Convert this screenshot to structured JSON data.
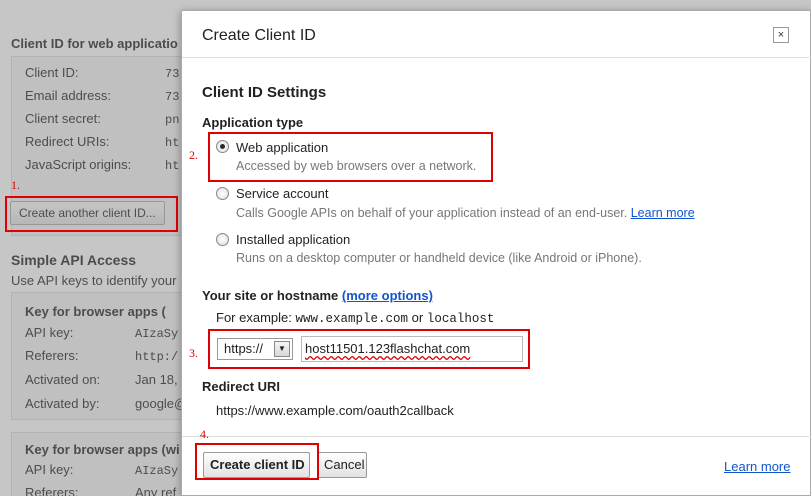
{
  "background": {
    "web_app_heading": "Client ID for web applicatio",
    "web_app_rows": [
      {
        "label": "Client ID:",
        "value": "73"
      },
      {
        "label": "Email address:",
        "value": "73"
      },
      {
        "label": "Client secret:",
        "value": "pn"
      },
      {
        "label": "Redirect URIs:",
        "value": "ht"
      },
      {
        "label": "JavaScript origins:",
        "value": "ht"
      }
    ],
    "create_another_button": "Create another client ID...",
    "simple_api_heading": "Simple API Access",
    "simple_api_desc": "Use API keys to identify your",
    "key_box_1": {
      "title": "Key for browser apps (",
      "rows": [
        {
          "label": "API key:",
          "value": "AIzaSy"
        },
        {
          "label": "Referers:",
          "value": "http:/"
        },
        {
          "label": "Activated on:",
          "value": "Jan 18,"
        },
        {
          "label": "Activated by:",
          "value": "google@"
        }
      ]
    },
    "key_box_2": {
      "title": "Key for browser apps (wi",
      "rows": [
        {
          "label": "API key:",
          "value": "AIzaSy"
        },
        {
          "label": "Referers:",
          "value": "Any ref"
        }
      ]
    }
  },
  "annotations": {
    "step1": "1.",
    "step2": "2.",
    "step3": "3.",
    "step4": "4."
  },
  "dialog": {
    "title": "Create Client ID",
    "close_icon": "×",
    "settings_heading": "Client ID Settings",
    "application_type_label": "Application type",
    "options": [
      {
        "label": "Web application",
        "description": "Accessed by web browsers over a network.",
        "checked": true
      },
      {
        "label": "Service account",
        "description": "Calls Google APIs on behalf of your application instead of an end-user.",
        "link": "Learn more",
        "checked": false
      },
      {
        "label": "Installed application",
        "description": "Runs on a desktop computer or handheld device (like Android or iPhone).",
        "checked": false
      }
    ],
    "site_label": "Your site or hostname",
    "more_options_link": "(more options)",
    "example_prefix": "For example:",
    "example_host1": "www.example.com",
    "example_or": "or",
    "example_host2": "localhost",
    "protocol_value": "https://",
    "hostname_value": "host11501.123flashchat.com",
    "redirect_label": "Redirect URI",
    "redirect_value": "https://www.example.com/oauth2callback",
    "create_button": "Create client ID",
    "cancel_button": "Cancel",
    "footer_link": "Learn more"
  },
  "colors": {
    "annotation_red": "#e00000",
    "link_blue": "#1155cc"
  }
}
